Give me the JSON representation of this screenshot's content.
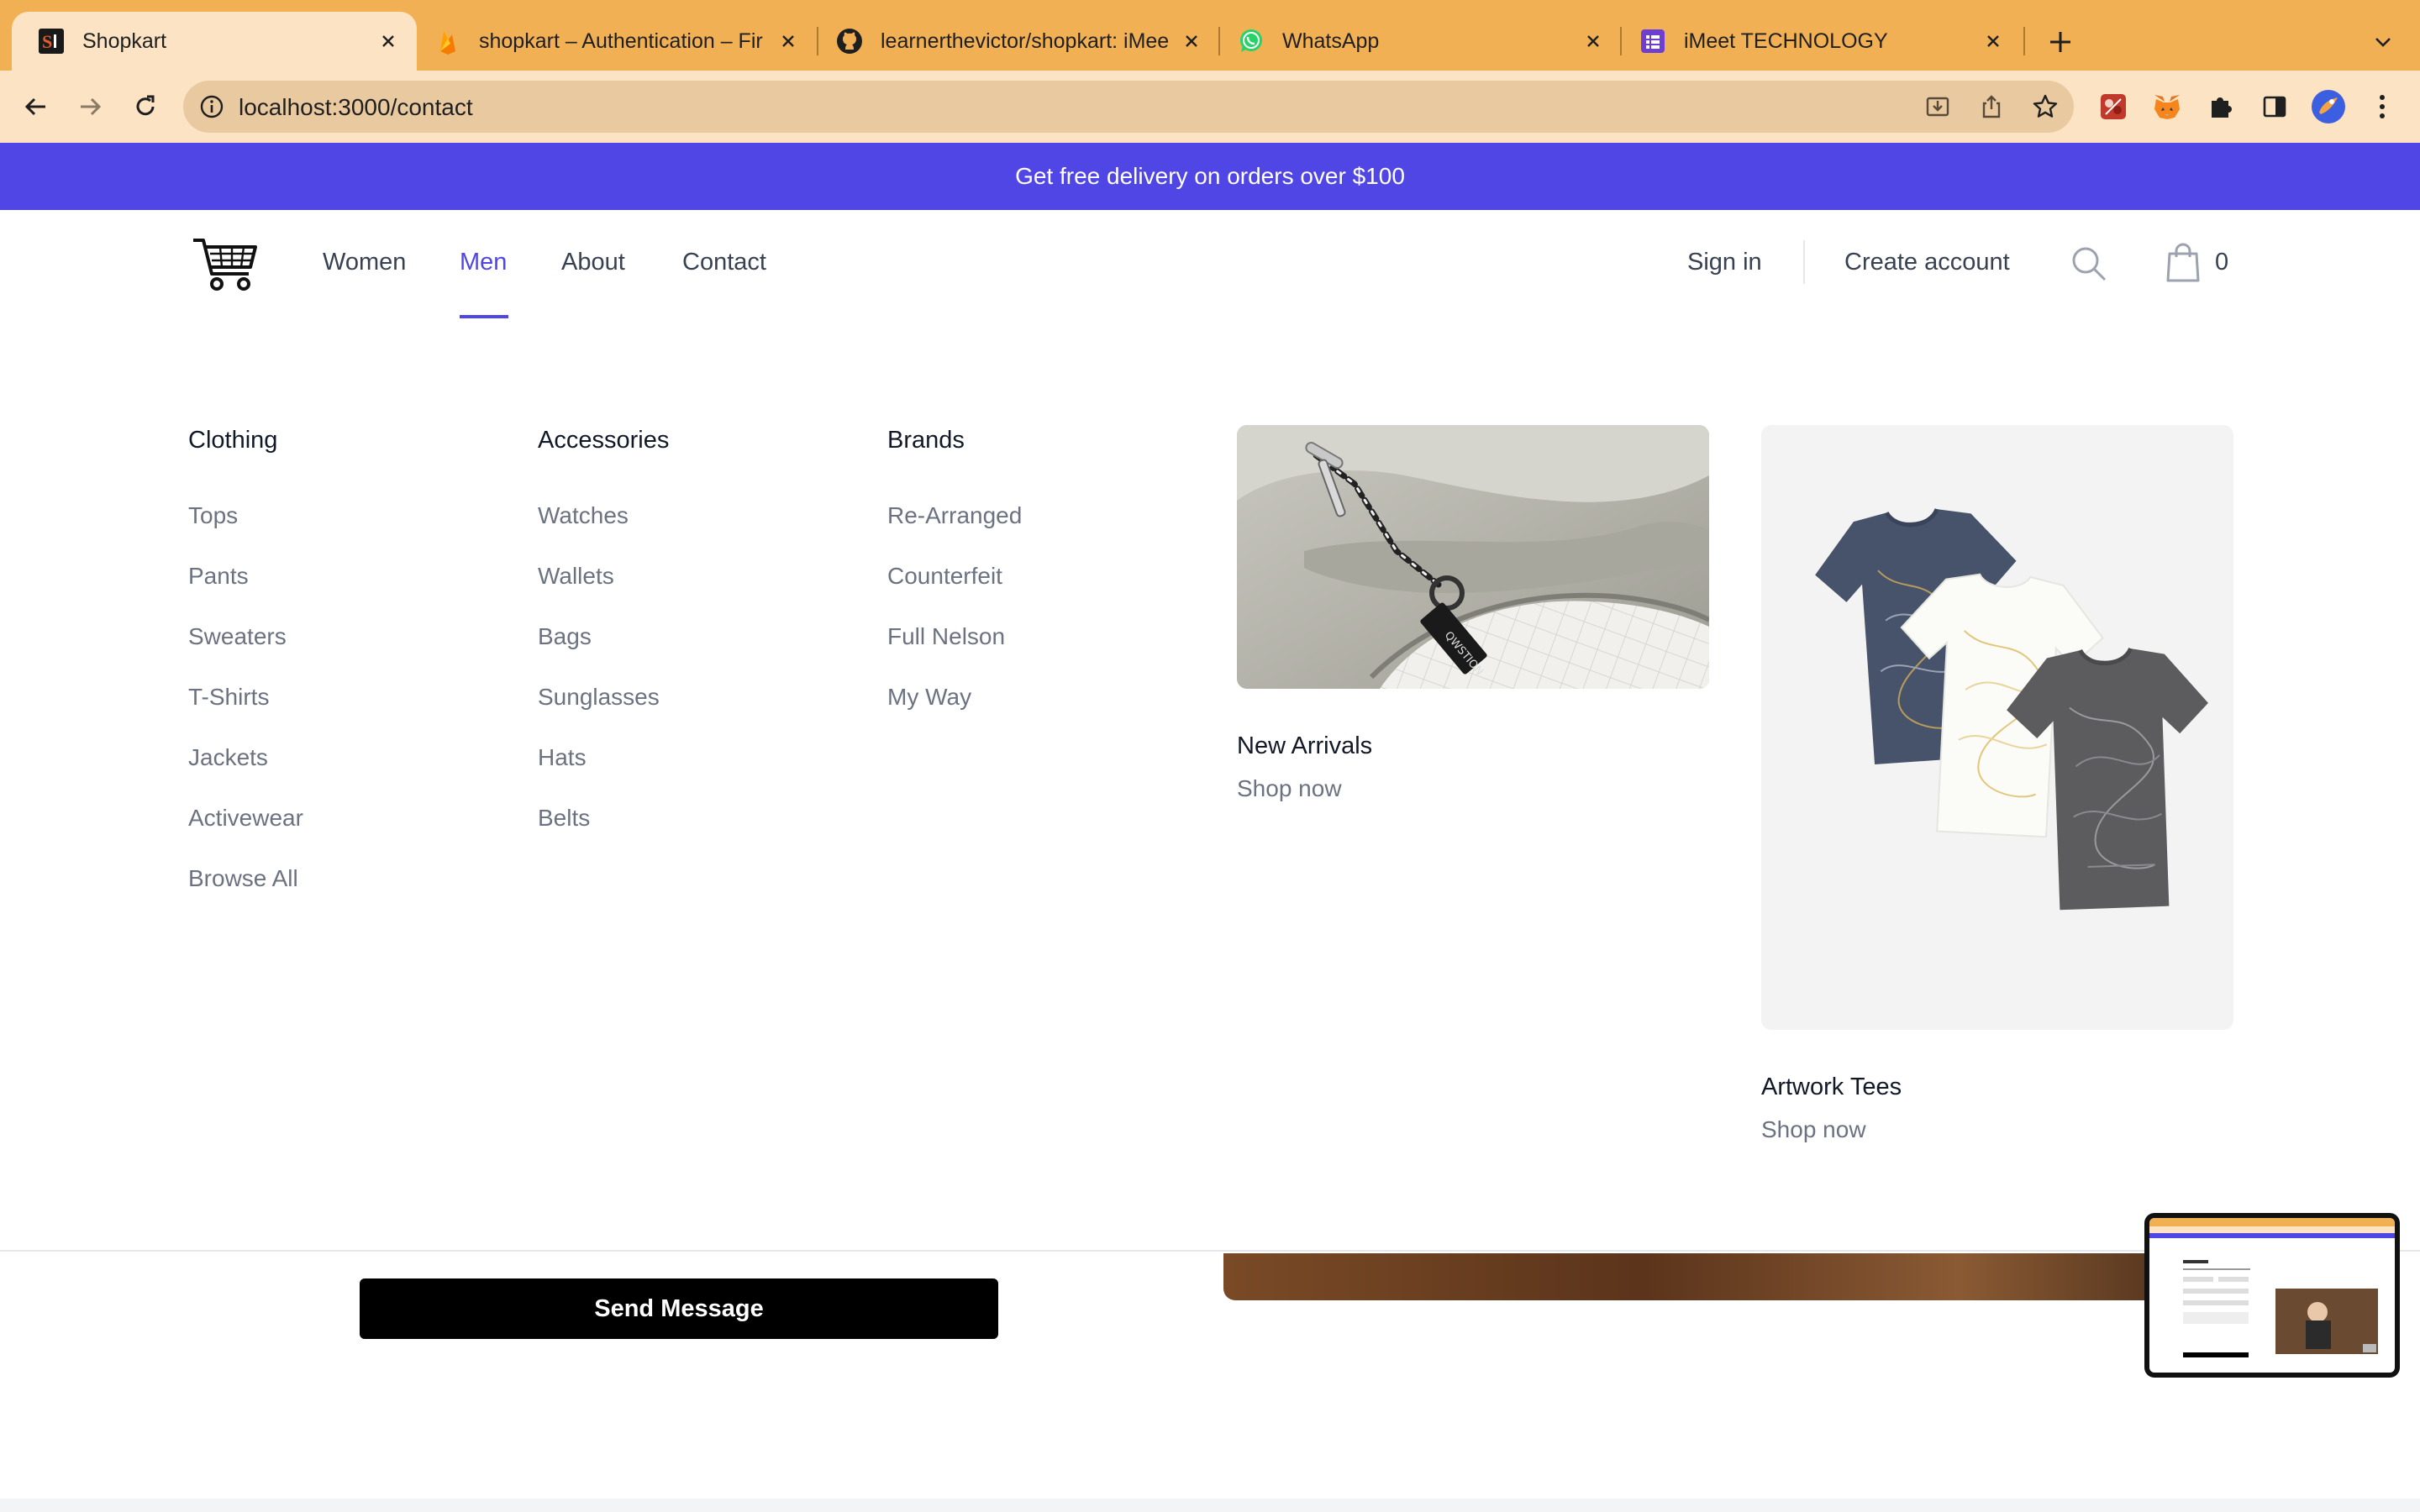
{
  "browser": {
    "tabs": [
      {
        "title": "Shopkart",
        "icon": "shopkart-favicon"
      },
      {
        "title": "shopkart – Authentication – Fir",
        "icon": "firebase-favicon"
      },
      {
        "title": "learnerthevictor/shopkart: iMee",
        "icon": "github-favicon"
      },
      {
        "title": "WhatsApp",
        "icon": "whatsapp-favicon"
      },
      {
        "title": "iMeet TECHNOLOGY",
        "icon": "imeet-favicon"
      }
    ],
    "url": "localhost:3000/contact"
  },
  "promo": {
    "text": "Get free delivery on orders over $100"
  },
  "nav": {
    "links": [
      "Women",
      "Men",
      "About",
      "Contact"
    ],
    "active": "Men",
    "sign_in": "Sign in",
    "create_account": "Create account",
    "cart_count": "0"
  },
  "menu": {
    "columns": [
      {
        "title": "Clothing",
        "items": [
          "Tops",
          "Pants",
          "Sweaters",
          "T-Shirts",
          "Jackets",
          "Activewear",
          "Browse All"
        ]
      },
      {
        "title": "Accessories",
        "items": [
          "Watches",
          "Wallets",
          "Bags",
          "Sunglasses",
          "Hats",
          "Belts"
        ]
      },
      {
        "title": "Brands",
        "items": [
          "Re-Arranged",
          "Counterfeit",
          "Full Nelson",
          "My Way"
        ]
      }
    ],
    "features": [
      {
        "name": "New Arrivals",
        "cta": "Shop now"
      },
      {
        "name": "Artwork Tees",
        "cta": "Shop now"
      }
    ]
  },
  "form": {
    "send_label": "Send Message"
  },
  "colors": {
    "accent": "#4f46e5",
    "tabbar": "#f2b055",
    "toolbar": "#fbe3c3"
  }
}
